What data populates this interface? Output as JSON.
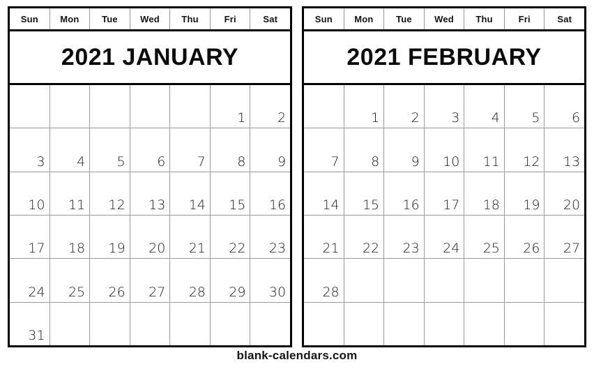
{
  "weekdays": [
    "Sun",
    "Mon",
    "Tue",
    "Wed",
    "Thu",
    "Fri",
    "Sat"
  ],
  "footer": {
    "text": "blank-calendars.com"
  },
  "colors": {
    "outer_border": "#000000",
    "grid_line": "#9a9a9a",
    "text": "#111111",
    "background": "#ffffff"
  },
  "months": [
    {
      "title": "2021 JANUARY",
      "year": "2021",
      "name": "JANUARY",
      "start_weekday": "Fri",
      "days_in_month": 31,
      "weeks": [
        [
          "",
          "",
          "",
          "",
          "",
          "1",
          "2"
        ],
        [
          "3",
          "4",
          "5",
          "6",
          "7",
          "8",
          "9"
        ],
        [
          "10",
          "11",
          "12",
          "13",
          "14",
          "15",
          "16"
        ],
        [
          "17",
          "18",
          "19",
          "20",
          "21",
          "22",
          "23"
        ],
        [
          "24",
          "25",
          "26",
          "27",
          "28",
          "29",
          "30"
        ],
        [
          "31",
          "",
          "",
          "",
          "",
          "",
          ""
        ]
      ]
    },
    {
      "title": "2021 FEBRUARY",
      "year": "2021",
      "name": "FEBRUARY",
      "start_weekday": "Mon",
      "days_in_month": 28,
      "weeks": [
        [
          "",
          "1",
          "2",
          "3",
          "4",
          "5",
          "6"
        ],
        [
          "7",
          "8",
          "9",
          "10",
          "11",
          "12",
          "13"
        ],
        [
          "14",
          "15",
          "16",
          "17",
          "18",
          "19",
          "20"
        ],
        [
          "21",
          "22",
          "23",
          "24",
          "25",
          "26",
          "27"
        ],
        [
          "28",
          "",
          "",
          "",
          "",
          "",
          ""
        ],
        [
          "",
          "",
          "",
          "",
          "",
          "",
          ""
        ]
      ]
    }
  ]
}
